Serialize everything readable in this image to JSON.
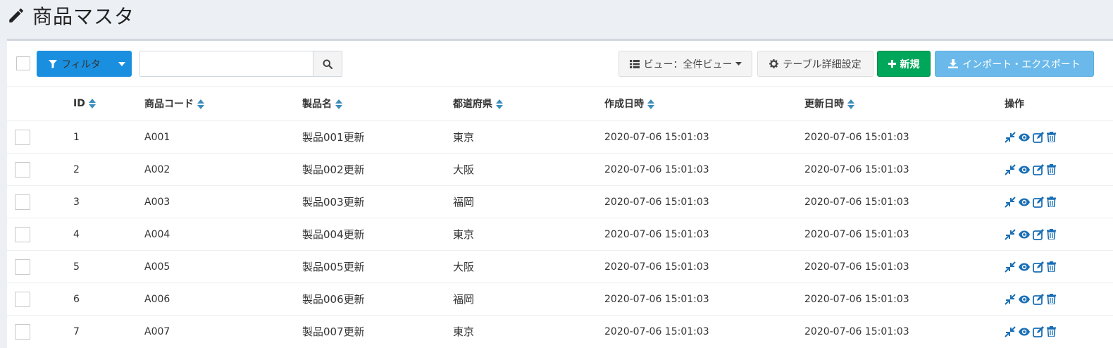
{
  "page": {
    "title": "商品マスタ"
  },
  "toolbar": {
    "filter_label": "フィルタ",
    "search_value": "",
    "search_placeholder": "",
    "view_label": "ビュー：全件ビュー",
    "settings_label": "テーブル詳細設定",
    "new_label": "新規",
    "import_label": "インポート・エクスポート"
  },
  "table": {
    "headers": {
      "id": "ID",
      "code": "商品コード",
      "name": "製品名",
      "pref": "都道府県",
      "created": "作成日時",
      "updated": "更新日時",
      "ops": "操作"
    },
    "rows": [
      {
        "id": "1",
        "code": "A001",
        "name": "製品001更新",
        "pref": "東京",
        "created": "2020-07-06 15:01:03",
        "updated": "2020-07-06 15:01:03"
      },
      {
        "id": "2",
        "code": "A002",
        "name": "製品002更新",
        "pref": "大阪",
        "created": "2020-07-06 15:01:03",
        "updated": "2020-07-06 15:01:03"
      },
      {
        "id": "3",
        "code": "A003",
        "name": "製品003更新",
        "pref": "福岡",
        "created": "2020-07-06 15:01:03",
        "updated": "2020-07-06 15:01:03"
      },
      {
        "id": "4",
        "code": "A004",
        "name": "製品004更新",
        "pref": "東京",
        "created": "2020-07-06 15:01:03",
        "updated": "2020-07-06 15:01:03"
      },
      {
        "id": "5",
        "code": "A005",
        "name": "製品005更新",
        "pref": "大阪",
        "created": "2020-07-06 15:01:03",
        "updated": "2020-07-06 15:01:03"
      },
      {
        "id": "6",
        "code": "A006",
        "name": "製品006更新",
        "pref": "福岡",
        "created": "2020-07-06 15:01:03",
        "updated": "2020-07-06 15:01:03"
      },
      {
        "id": "7",
        "code": "A007",
        "name": "製品007更新",
        "pref": "東京",
        "created": "2020-07-06 15:01:03",
        "updated": "2020-07-06 15:01:03"
      }
    ]
  },
  "colors": {
    "filter_button": "#1a8fe0",
    "new_button": "#00a65a",
    "import_button": "#6ab9ea",
    "action_icons": "#1a6fb5",
    "sort_icons": "#3c8dbc"
  },
  "icons": {
    "title": "pencil-icon",
    "filter": "filter-icon",
    "search": "search-icon",
    "view": "list-icon",
    "settings": "gear-icon",
    "new": "plus-icon",
    "import": "download-icon",
    "row_actions": [
      "compress-icon",
      "eye-icon",
      "edit-icon",
      "trash-icon"
    ]
  }
}
